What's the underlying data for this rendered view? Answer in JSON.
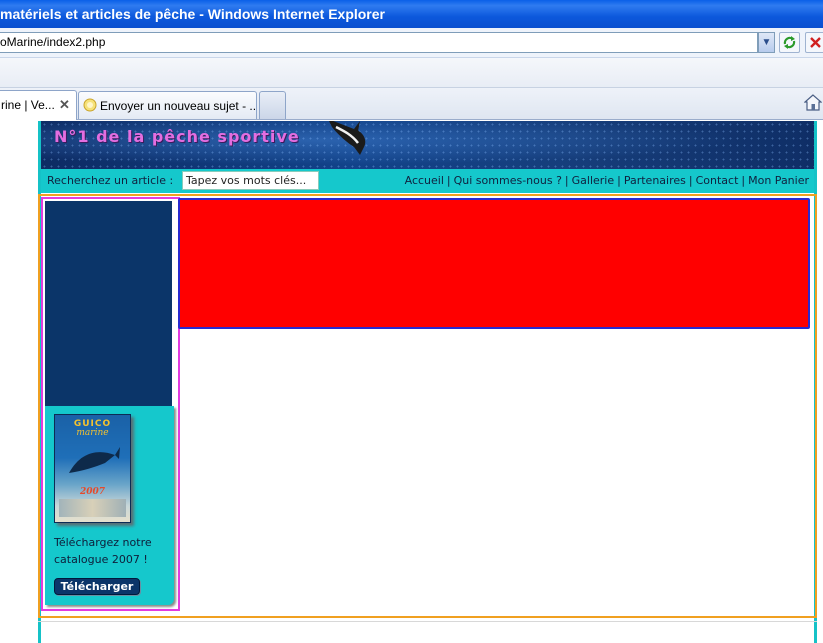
{
  "window": {
    "title": "matériels et articles de pêche - Windows Internet Explorer"
  },
  "address_bar": {
    "url": "oMarine/index2.php"
  },
  "tabs": [
    {
      "label": "rine | Ve...",
      "active": true
    },
    {
      "label": "Envoyer un nouveau sujet - ...",
      "active": false
    },
    {
      "label": "",
      "active": false
    }
  ],
  "page": {
    "banner_slogan": "N°1 de la pêche sportive",
    "search": {
      "label": "Recherchez un article :",
      "value": "Tapez vos mots clés..."
    },
    "nav": [
      "Accueil",
      "Qui sommes-nous ?",
      "Gallerie",
      "Partenaires",
      "Contact",
      "Mon Panier"
    ],
    "sidebar": {
      "catalog_brand": "GUICO",
      "catalog_brand_sub": "marine",
      "catalog_year": "2007",
      "catalog_text": "Téléchargez notre catalogue 2007 !",
      "download_button": "Télécharger"
    }
  },
  "colors": {
    "accent_cyan": "#15c8cc",
    "sidebar_navy": "#0b3569",
    "red_block": "#ff0000",
    "slogan_pink": "#e36ee0"
  }
}
